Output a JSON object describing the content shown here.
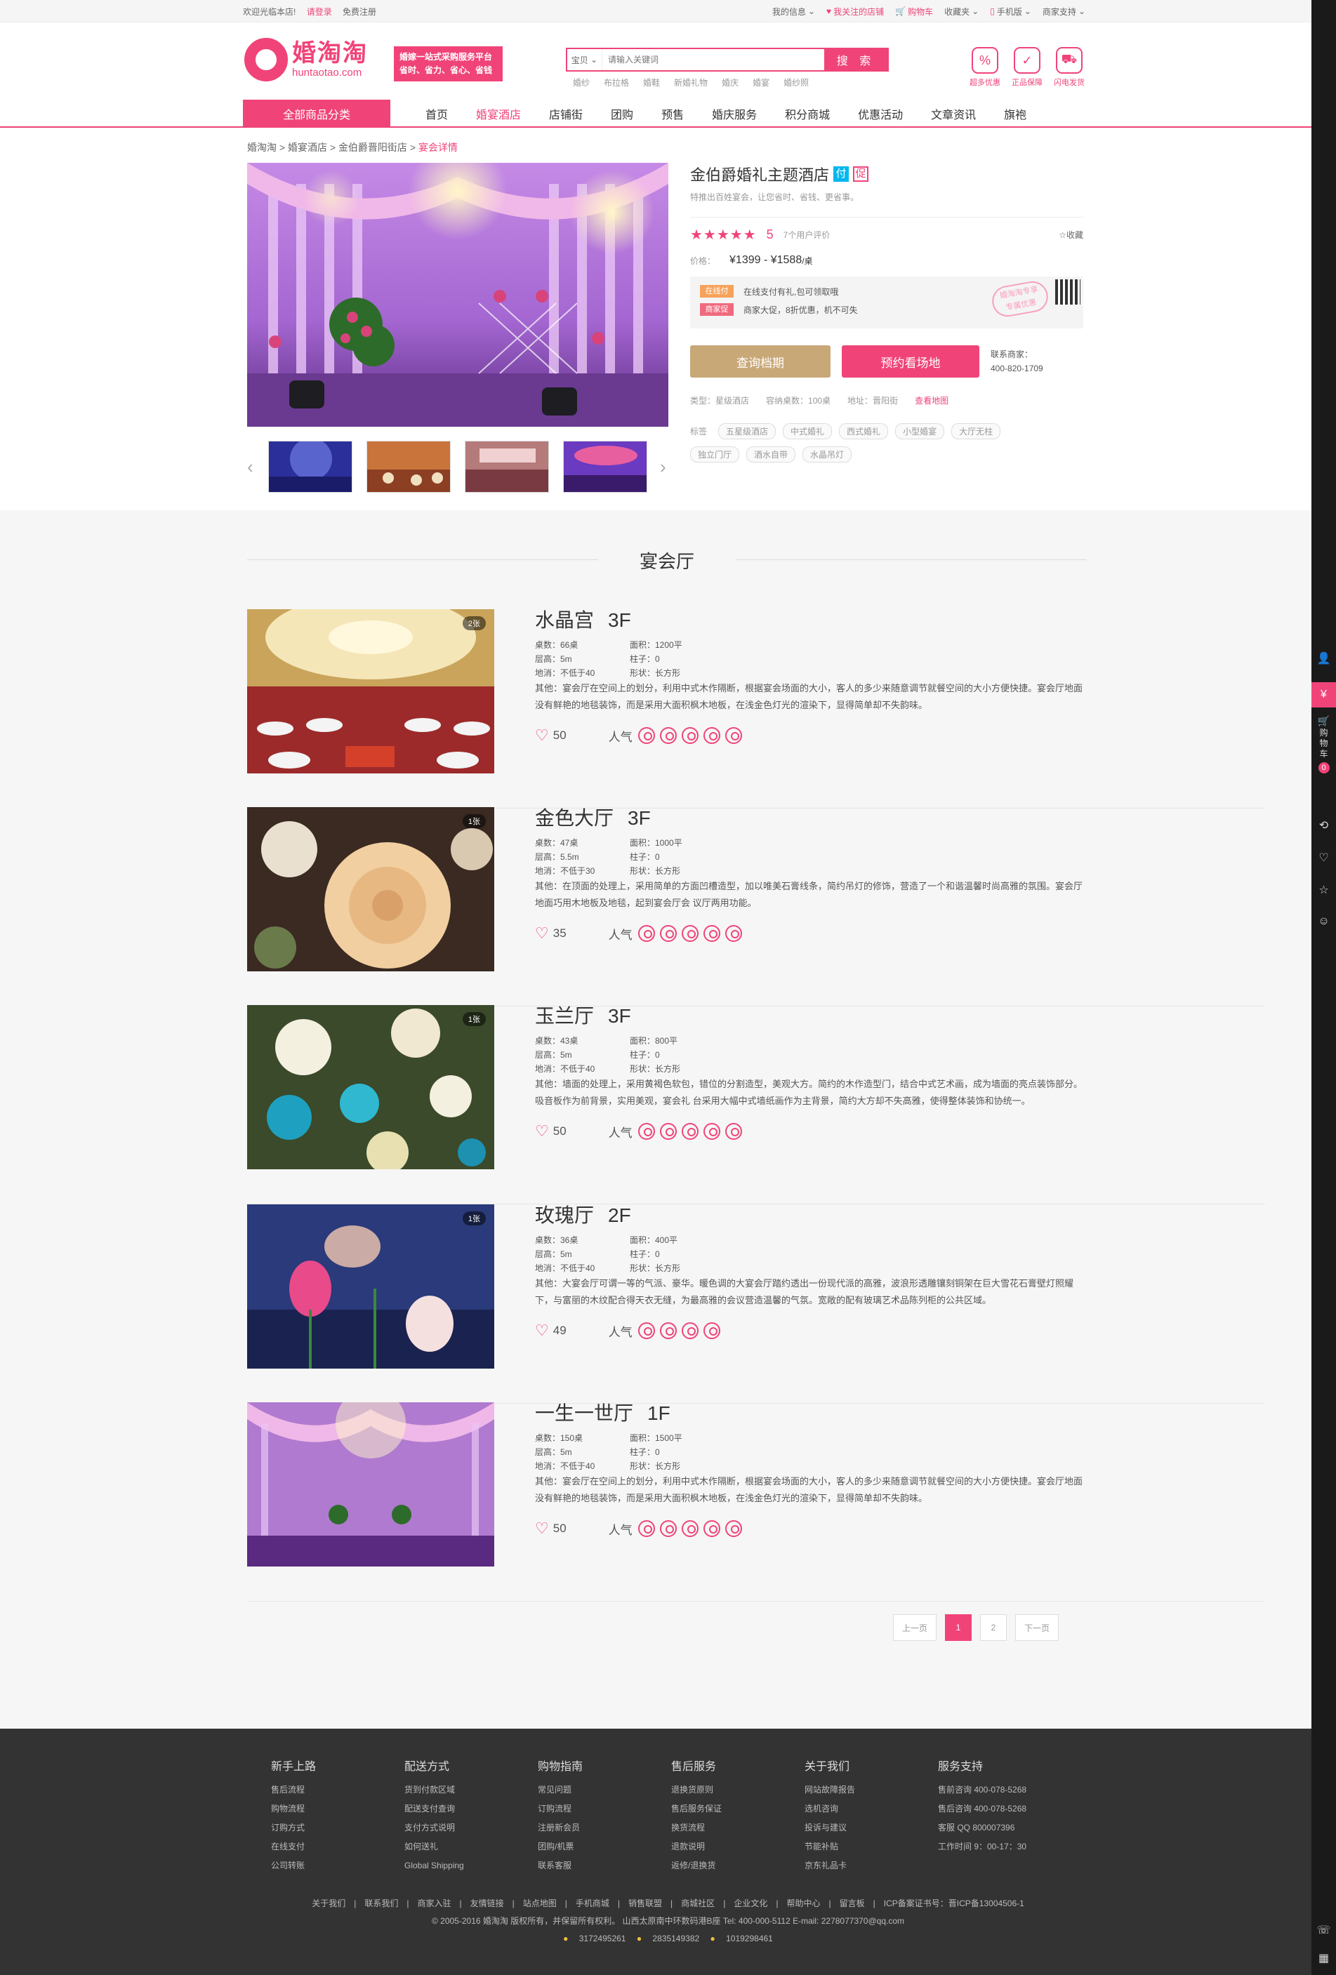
{
  "topbar": {
    "welcome": "欢迎光临本店!",
    "login": "请登录",
    "register": "免费注册",
    "links": [
      "我的信息",
      "我关注的店铺",
      "购物车",
      "收藏夹",
      "手机版",
      "商家支持"
    ]
  },
  "header": {
    "logo_cn": "婚淘淘",
    "logo_en": "huntaotao.com",
    "slogan_line1": "婚嫁一站式采购服务平台",
    "slogan_line2": "省时、省力、省心、省钱",
    "search_type": "宝贝",
    "search_placeholder": "请输入关键词",
    "search_button": "搜 索",
    "hotwords": [
      "婚纱",
      "布拉格",
      "婚鞋",
      "新婚礼物",
      "婚庆",
      "婚宴",
      "婚纱照"
    ],
    "badges": [
      "超多优惠",
      "正品保障",
      "闪电发货"
    ]
  },
  "nav": {
    "category_button": "全部商品分类",
    "items": [
      "首页",
      "婚宴酒店",
      "店铺街",
      "团购",
      "预售",
      "婚庆服务",
      "积分商城",
      "优惠活动",
      "文章资讯",
      "旗袍"
    ],
    "active_index": 1
  },
  "breadcrumb": [
    "婚淘淘",
    "婚宴酒店",
    "金伯爵晋阳街店",
    "宴会详情"
  ],
  "product": {
    "title": "金伯爵婚礼主题酒店",
    "tag_fu": "付",
    "tag_cu": "促",
    "subtitle": "特推出百姓宴会，让您省时、省钱、更省事。",
    "stars": "★★★★★",
    "score": "5",
    "reviews": "7个用户评价",
    "favorite": "收藏",
    "price_label": "价格：",
    "price": "¥1399 - ¥1588",
    "price_unit": "/桌",
    "promos": [
      {
        "label": "在线付",
        "text": "在线支付有礼,包可领取哦",
        "color": "#f7a25a"
      },
      {
        "label": "商家促",
        "text": "商家大促，8折优惠，机不可失",
        "color": "#f06a7e"
      }
    ],
    "stamp_line1": "婚淘淘专享",
    "stamp_line2": "专属优惠",
    "btn_query": "查询档期",
    "btn_book": "预约看场地",
    "contact_label": "联系商家：",
    "contact_phone": "400-820-1709",
    "meta_type": "类型：星级酒店",
    "meta_tables": "容纳桌数：100桌",
    "meta_address": "地址：晋阳街",
    "map_link": "查看地图",
    "tags_label": "标签",
    "tags": [
      "五星级酒店",
      "中式婚礼",
      "西式婚礼",
      "小型婚宴",
      "大厅无柱",
      "独立门厅",
      "酒水自带",
      "水晶吊灯"
    ]
  },
  "hall_section_title": "宴会厅",
  "halls": [
    {
      "name": "水晶宫",
      "floor": "3F",
      "count": "2张",
      "tables": "桌数：66桌",
      "area": "面积：1200平",
      "height": "层高：5m",
      "pillar": "柱子：0",
      "min": "地消：不低于40",
      "shape": "形状：长方形",
      "desc": "其他：宴会厅在空间上的划分，利用中式木作隔断，根据宴会场面的大小，客人的多少来随意调节就餐空间的大小方便快捷。宴会厅地面没有鲜艳的地毯装饰，而是采用大面积枫木地板，在浅金色灯光的渲染下，显得简单却不失韵味。",
      "likes": "50",
      "popularity": "人气",
      "medals": 5
    },
    {
      "name": "金色大厅",
      "floor": "3F",
      "count": "1张",
      "tables": "桌数：47桌",
      "area": "面积：1000平",
      "height": "层高：5.5m",
      "pillar": "柱子：0",
      "min": "地消：不低于30",
      "shape": "形状：长方形",
      "desc": "其他：在顶面的处理上，采用简单的方面凹槽造型，加以唯美石膏线条，简约吊灯的修饰，营造了一个和谐温馨时尚高雅的氛围。宴会厅地面巧用木地板及地毯，起到宴会厅会  议厅两用功能。",
      "likes": "35",
      "popularity": "人气",
      "medals": 5
    },
    {
      "name": "玉兰厅",
      "floor": "3F",
      "count": "1张",
      "tables": "桌数：43桌",
      "area": "面积：800平",
      "height": "层高：5m",
      "pillar": "柱子：0",
      "min": "地消：不低于40",
      "shape": "形状：长方形",
      "desc": "其他：墙面的处理上，采用黄褐色软包，错位的分割造型，美观大方。简约的木作造型门，结合中式艺术画，成为墙面的亮点装饰部分。吸音板作为前背景，实用美观，宴会礼  台采用大幅中式墙纸画作为主背景，简约大方却不失高雅，使得整体装饰和协统一。",
      "likes": "50",
      "popularity": "人气",
      "medals": 5
    },
    {
      "name": "玫瑰厅",
      "floor": "2F",
      "count": "1张",
      "tables": "桌数：36桌",
      "area": "面积：400平",
      "height": "层高：5m",
      "pillar": "柱子：0",
      "min": "地消：不低于40",
      "shape": "形状：长方形",
      "desc": "其他：大宴会厅可谓一等的气派、豪华。暖色调的大宴会厅踏约透出一份现代派的高雅，波浪形透雕镶刻铜架在巨大雪花石膏壁灯照耀下，与富丽的木纹配合得天衣无缝，为最高雅的会议营造温馨的气氛。宽敞的配有玻璃艺术品陈列柜的公共区域。",
      "likes": "49",
      "popularity": "人气",
      "medals": 4
    },
    {
      "name": "一生一世厅",
      "floor": "1F",
      "count": "",
      "tables": "桌数：150桌",
      "area": "面积：1500平",
      "height": "层高：5m",
      "pillar": "柱子：0",
      "min": "地消：不低于40",
      "shape": "形状：长方形",
      "desc": "其他：宴会厅在空间上的划分，利用中式木作隔断，根据宴会场面的大小，客人的多少来随意调节就餐空间的大小方便快捷。宴会厅地面没有鲜艳的地毯装饰，而是采用大面积枫木地板，在浅金色灯光的渲染下，显得简单却不失韵味。",
      "likes": "50",
      "popularity": "人气",
      "medals": 5
    }
  ],
  "pagination": {
    "prev": "上一页",
    "pages": [
      "1",
      "2"
    ],
    "current": "1",
    "next": "下一页"
  },
  "footer": {
    "columns": [
      {
        "title": "新手上路",
        "items": [
          "售后流程",
          "购物流程",
          "订购方式",
          "在线支付",
          "公司转账"
        ]
      },
      {
        "title": "配送方式",
        "items": [
          "货到付款区域",
          "配送支付查询",
          "支付方式说明",
          "如何送礼",
          "Global Shipping"
        ]
      },
      {
        "title": "购物指南",
        "items": [
          "常见问题",
          "订购流程",
          "注册新会员",
          "团购/机票",
          "联系客服"
        ]
      },
      {
        "title": "售后服务",
        "items": [
          "退换货原则",
          "售后服务保证",
          "换货流程",
          "退款说明",
          "返修/退换货"
        ]
      },
      {
        "title": "关于我们",
        "items": [
          "网站故障报告",
          "选机咨询",
          "投诉与建议",
          "节能补贴",
          "京东礼品卡"
        ]
      },
      {
        "title": "服务支持",
        "items": [
          "售前咨询 400-078-5268",
          "售后咨询 400-078-5268",
          "客服 QQ 800007396",
          "工作时间 9：00-17：30"
        ]
      }
    ],
    "links": [
      "关于我们",
      "联系我们",
      "商家入驻",
      "友情链接",
      "站点地图",
      "手机商城",
      "销售联盟",
      "商城社区",
      "企业文化",
      "帮助中心",
      "留言板",
      "ICP备案证书号：晋ICP备13004506-1"
    ],
    "copyright": "© 2005-2016 婚淘淘 版权所有，并保留所有权利。 山西太原南中环数码港B座 Tel: 400-000-5112 E-mail: 2278077370@qq.com",
    "qq": [
      "3172495261",
      "2835149382",
      "1019298461"
    ]
  },
  "sidebar": {
    "cart_label": "购物车",
    "cart_count": "0"
  }
}
